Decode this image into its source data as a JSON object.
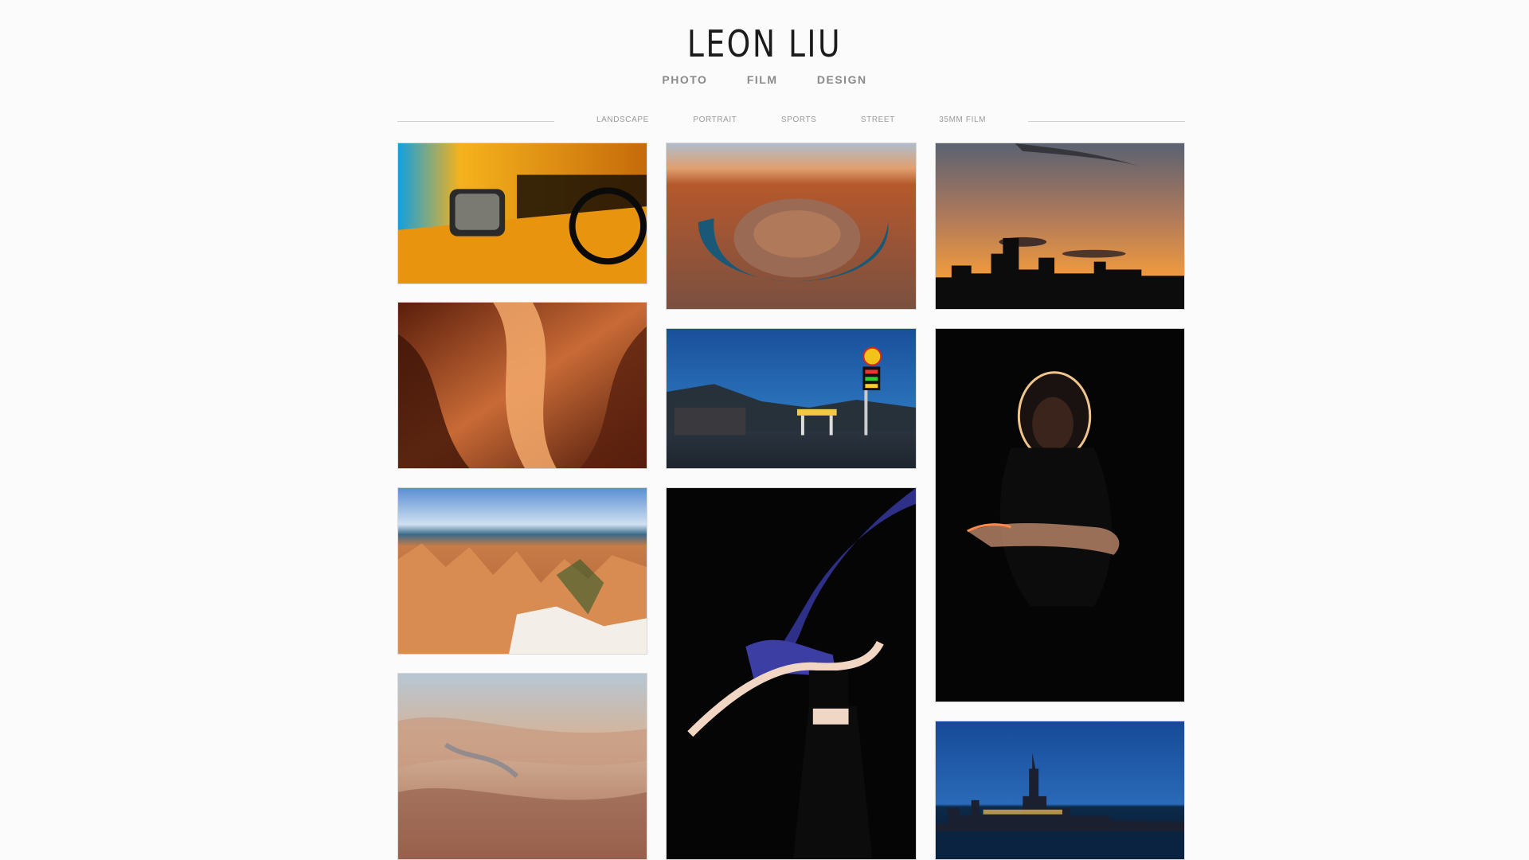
{
  "site": {
    "title": "LEON LIU"
  },
  "main_nav": [
    "PHOTO",
    "FILM",
    "DESIGN"
  ],
  "categories": [
    "LANDSCAPE",
    "PORTRAIT",
    "SPORTS",
    "STREET",
    "35MM FILM"
  ],
  "gallery": {
    "photos": [
      {
        "subject": "taxi-side-mirror",
        "colors": [
          "#f0a01a",
          "#1c9fd8",
          "#111111"
        ]
      },
      {
        "subject": "horseshoe-bend-canyon",
        "colors": [
          "#8a5a42",
          "#1e5d78",
          "#d27c4a"
        ]
      },
      {
        "subject": "city-skyline-sunset",
        "colors": [
          "#e58a3c",
          "#555b6a",
          "#0c0c0c"
        ]
      },
      {
        "subject": "antelope-slot-canyon",
        "colors": [
          "#7a2e18",
          "#d9864a",
          "#4a1a0c"
        ]
      },
      {
        "subject": "gas-station-dusk",
        "colors": [
          "#1f5aa6",
          "#2f3a48",
          "#f2c84a"
        ]
      },
      {
        "subject": "backlit-portrait",
        "colors": [
          "#060606",
          "#e4b07a",
          "#0a0a0a"
        ]
      },
      {
        "subject": "bryce-canyon-hoodoos",
        "colors": [
          "#d07e47",
          "#5c8fd0",
          "#f2e9df"
        ]
      },
      {
        "subject": "dancer-with-fabric",
        "colors": [
          "#060606",
          "#3d3fa0",
          "#f0d6c4"
        ]
      },
      {
        "subject": "grand-canyon-aerial",
        "colors": [
          "#c8a58c",
          "#7a8fa6",
          "#a46b52"
        ]
      },
      {
        "subject": "city-skyline-night",
        "colors": [
          "#1c4d9a",
          "#08223f",
          "#f2c25a"
        ]
      }
    ]
  }
}
